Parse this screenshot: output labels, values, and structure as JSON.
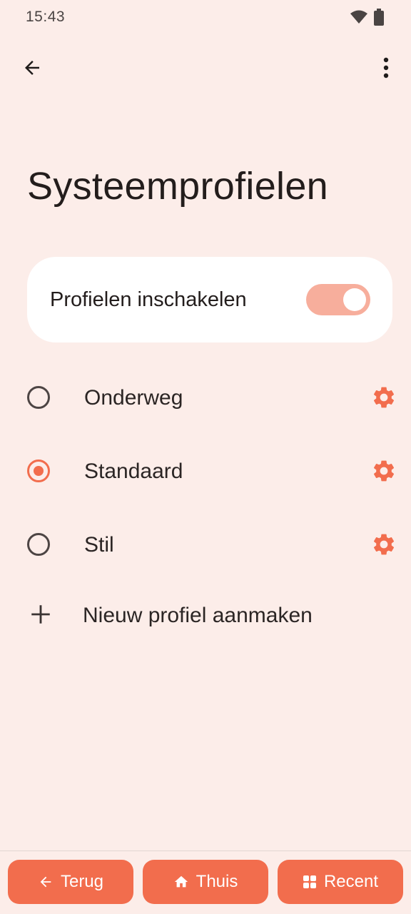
{
  "status_bar": {
    "time": "15:43",
    "icons": [
      "wifi-icon",
      "battery-icon"
    ]
  },
  "app_bar": {
    "back_icon": "arrow-left-icon",
    "menu_icon": "more-vertical-icon"
  },
  "page": {
    "title": "Systeemprofielen"
  },
  "enable_card": {
    "label": "Profielen inschakelen",
    "enabled": true
  },
  "profiles": [
    {
      "label": "Onderweg",
      "selected": false
    },
    {
      "label": "Standaard",
      "selected": true
    },
    {
      "label": "Stil",
      "selected": false
    }
  ],
  "add_profile": {
    "label": "Nieuw profiel aanmaken",
    "icon": "plus-icon"
  },
  "nav": {
    "back_label": "Terug",
    "home_label": "Thuis",
    "recent_label": "Recent"
  },
  "colors": {
    "background": "#FCEDE9",
    "accent": "#F26D4D",
    "switch_track": "#F7AE9C",
    "card": "#FFFFFF"
  }
}
